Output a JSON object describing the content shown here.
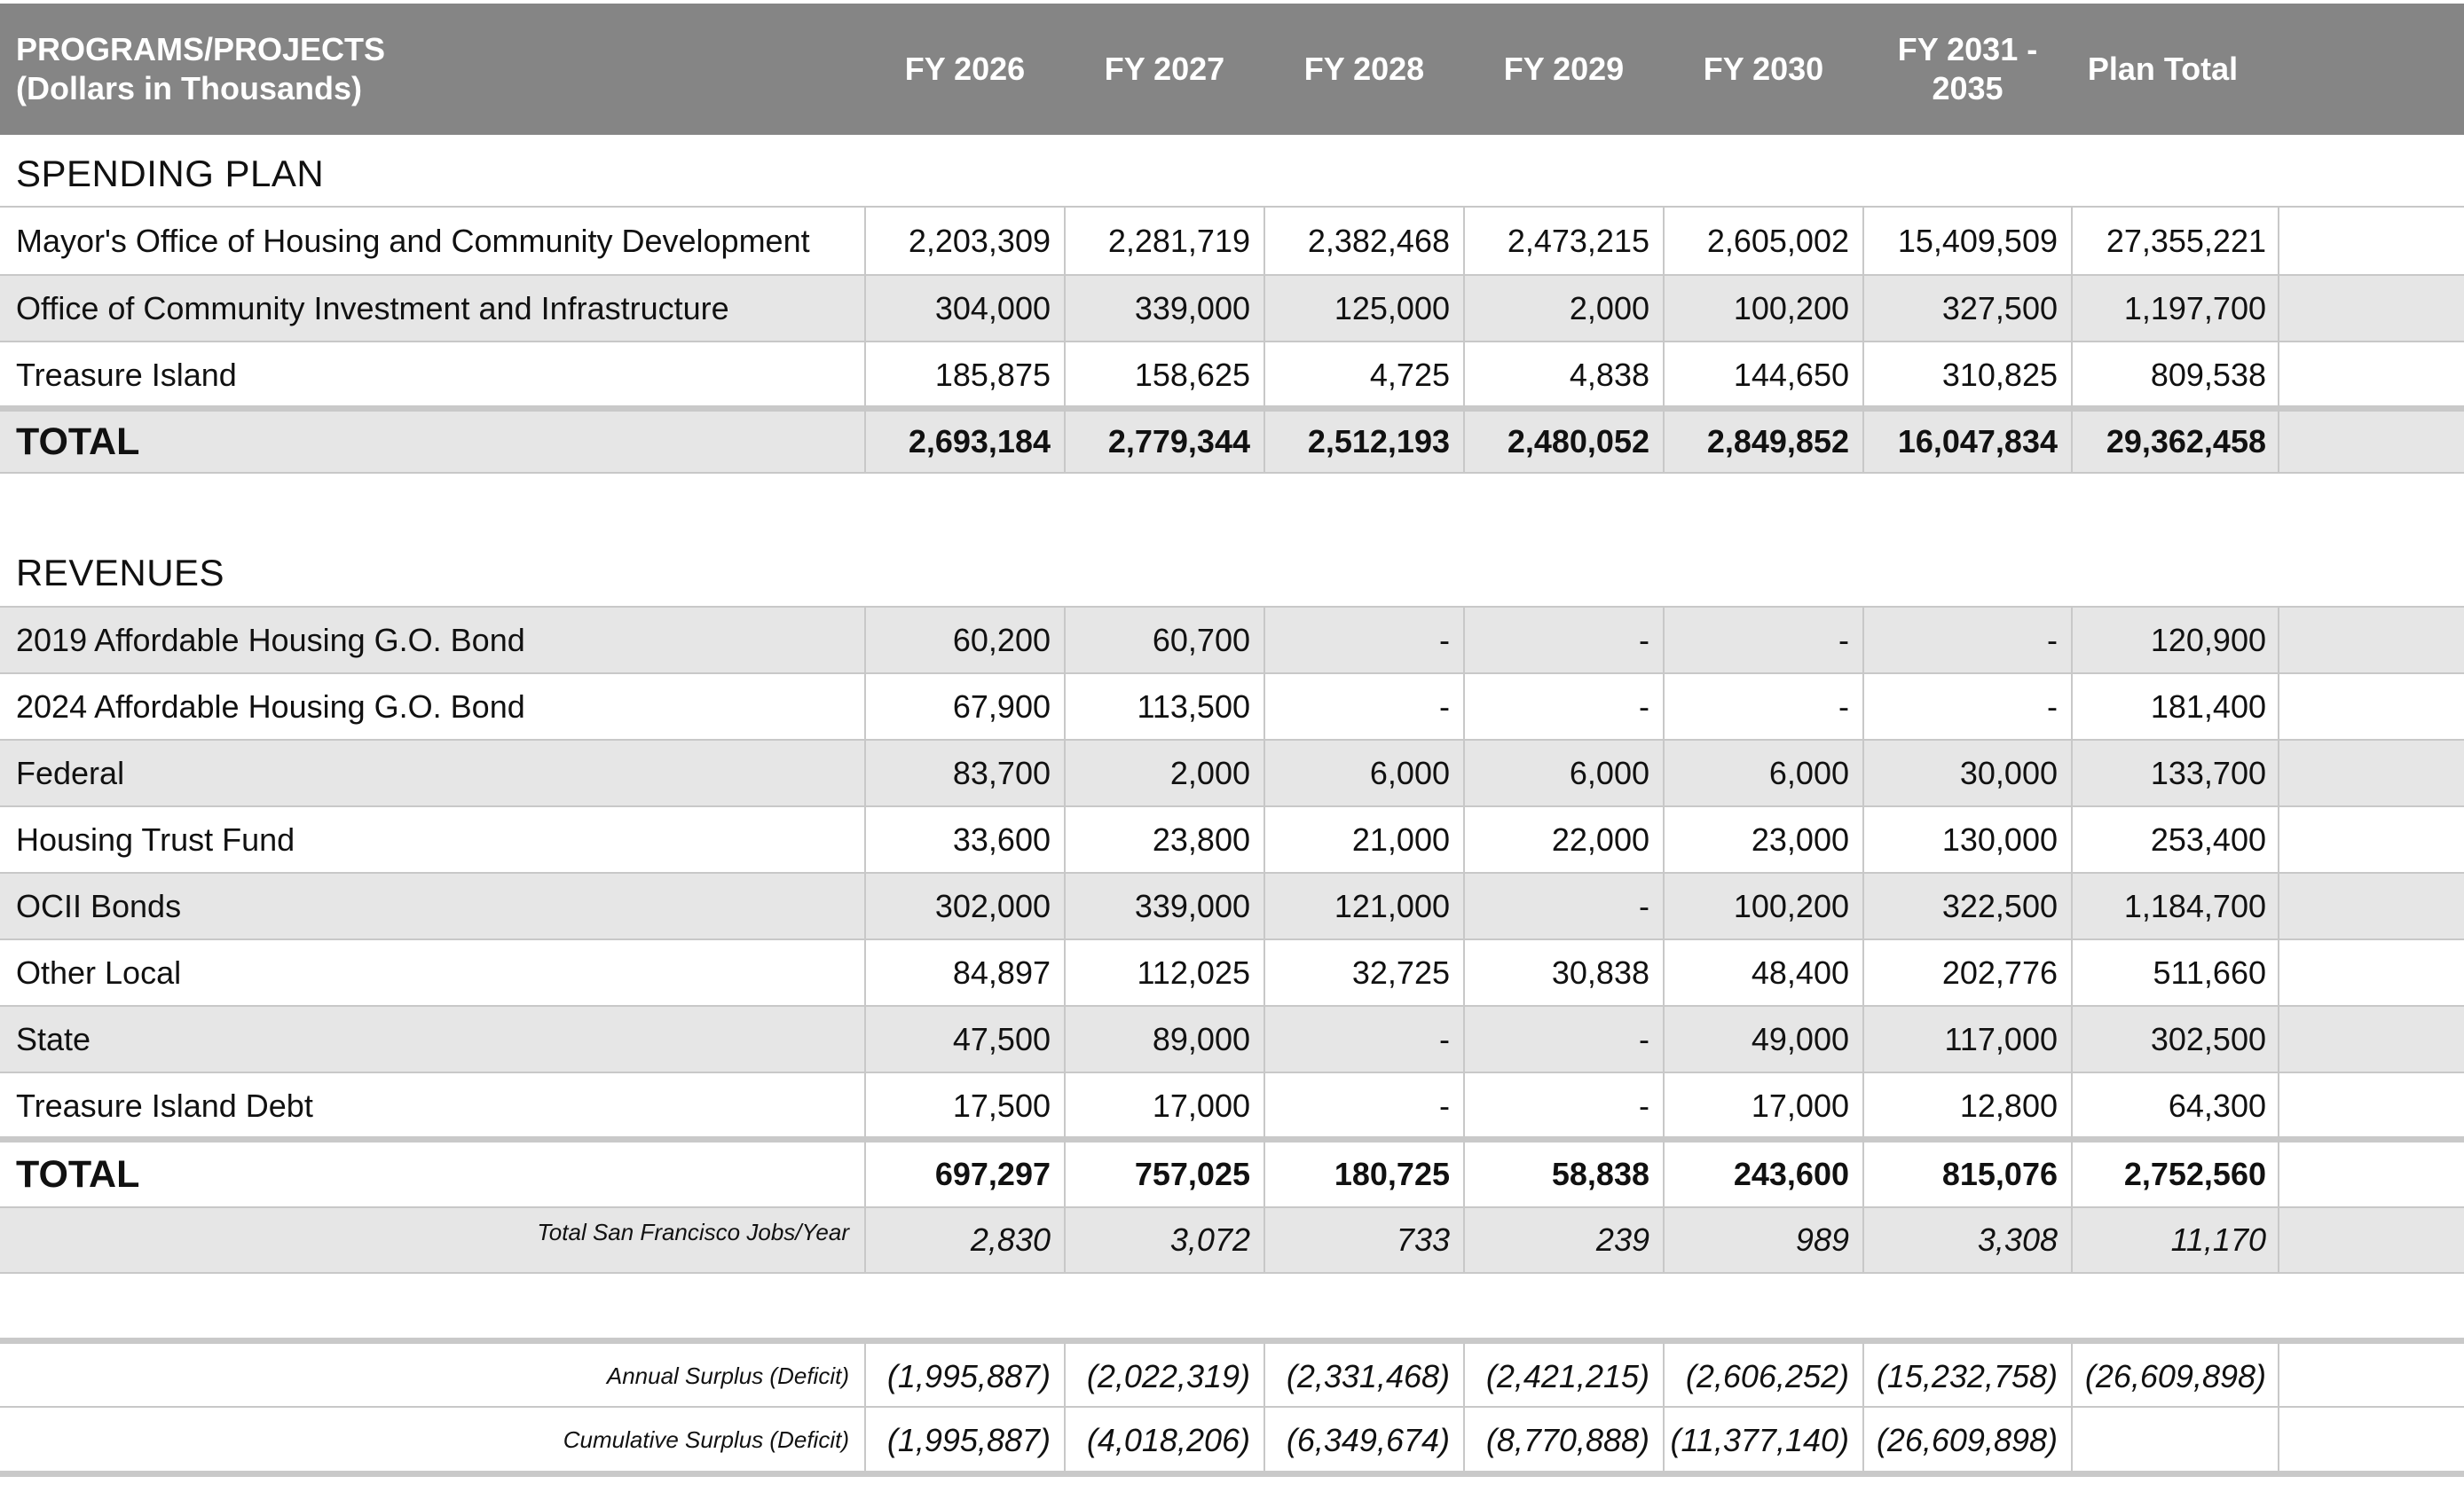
{
  "header": {
    "label_line1": "PROGRAMS/PROJECTS",
    "label_line2": "(Dollars in Thousands)",
    "columns": [
      {
        "line1": "FY 2026",
        "line2": ""
      },
      {
        "line1": "FY 2027",
        "line2": ""
      },
      {
        "line1": "FY 2028",
        "line2": ""
      },
      {
        "line1": "FY 2029",
        "line2": ""
      },
      {
        "line1": "FY 2030",
        "line2": ""
      },
      {
        "line1": "FY 2031 -",
        "line2": "2035"
      },
      {
        "line1": "Plan Total",
        "line2": ""
      }
    ]
  },
  "spending": {
    "title": "SPENDING PLAN",
    "rows": [
      {
        "label": "Mayor's Office of Housing and Community Development",
        "values": [
          "2,203,309",
          "2,281,719",
          "2,382,468",
          "2,473,215",
          "2,605,002",
          "15,409,509",
          "27,355,221"
        ]
      },
      {
        "label": "Office of Community Investment and Infrastructure",
        "values": [
          "304,000",
          "339,000",
          "125,000",
          "2,000",
          "100,200",
          "327,500",
          "1,197,700"
        ]
      },
      {
        "label": "Treasure Island",
        "values": [
          "185,875",
          "158,625",
          "4,725",
          "4,838",
          "144,650",
          "310,825",
          "809,538"
        ]
      }
    ],
    "total": {
      "label": "TOTAL",
      "values": [
        "2,693,184",
        "2,779,344",
        "2,512,193",
        "2,480,052",
        "2,849,852",
        "16,047,834",
        "29,362,458"
      ]
    }
  },
  "revenues": {
    "title": "REVENUES",
    "rows": [
      {
        "label": "2019 Affordable Housing G.O. Bond",
        "values": [
          "60,200",
          "60,700",
          "-",
          "-",
          "-",
          "-",
          "120,900"
        ]
      },
      {
        "label": "2024 Affordable Housing G.O. Bond",
        "values": [
          "67,900",
          "113,500",
          "-",
          "-",
          "-",
          "-",
          "181,400"
        ]
      },
      {
        "label": "Federal",
        "values": [
          "83,700",
          "2,000",
          "6,000",
          "6,000",
          "6,000",
          "30,000",
          "133,700"
        ]
      },
      {
        "label": "Housing Trust Fund",
        "values": [
          "33,600",
          "23,800",
          "21,000",
          "22,000",
          "23,000",
          "130,000",
          "253,400"
        ]
      },
      {
        "label": "OCII Bonds",
        "values": [
          "302,000",
          "339,000",
          "121,000",
          "-",
          "100,200",
          "322,500",
          "1,184,700"
        ]
      },
      {
        "label": "Other Local",
        "values": [
          "84,897",
          "112,025",
          "32,725",
          "30,838",
          "48,400",
          "202,776",
          "511,660"
        ]
      },
      {
        "label": "State",
        "values": [
          "47,500",
          "89,000",
          "-",
          "-",
          "49,000",
          "117,000",
          "302,500"
        ]
      },
      {
        "label": "Treasure Island Debt",
        "values": [
          "17,500",
          "17,000",
          "-",
          "-",
          "17,000",
          "12,800",
          "64,300"
        ]
      }
    ],
    "total": {
      "label": "TOTAL",
      "values": [
        "697,297",
        "757,025",
        "180,725",
        "58,838",
        "243,600",
        "815,076",
        "2,752,560"
      ]
    },
    "jobs": {
      "label": "Total San Francisco Jobs/Year",
      "values": [
        "2,830",
        "3,072",
        "733",
        "239",
        "989",
        "3,308",
        "11,170"
      ]
    }
  },
  "surplus": {
    "annual": {
      "label": "Annual Surplus (Deficit)",
      "values": [
        "(1,995,887)",
        "(2,022,319)",
        "(2,331,468)",
        "(2,421,215)",
        "(2,606,252)",
        "(15,232,758)",
        "(26,609,898)"
      ]
    },
    "cumulative": {
      "label": "Cumulative Surplus (Deficit)",
      "values": [
        "(1,995,887)",
        "(4,018,206)",
        "(6,349,674)",
        "(8,770,888)",
        "(11,377,140)",
        "(26,609,898)",
        ""
      ]
    }
  }
}
